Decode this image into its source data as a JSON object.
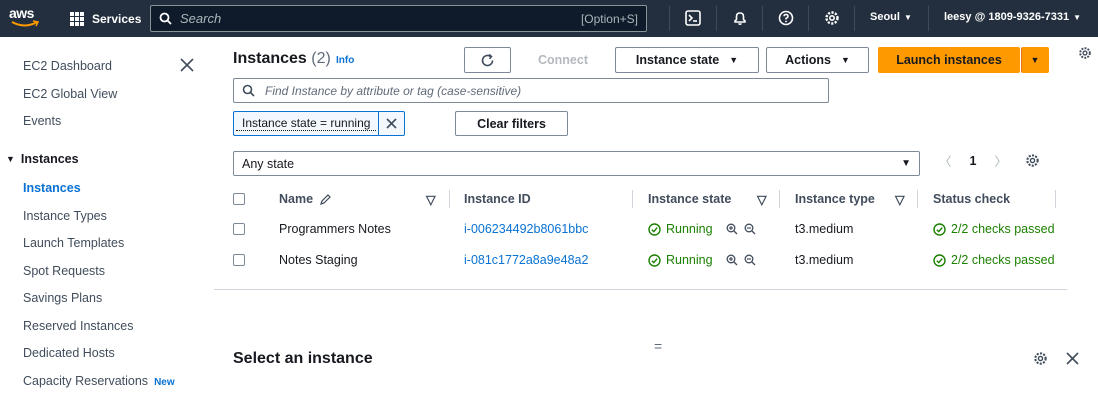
{
  "topnav": {
    "logo_text": "aws",
    "services_label": "Services",
    "search_placeholder": "Search",
    "search_shortcut": "[Option+S]",
    "region": "Seoul",
    "account": "leesy @ 1809-9326-7331",
    "icons": [
      "cloudshell-icon",
      "bell-icon",
      "help-icon",
      "settings-icon"
    ]
  },
  "sidebar": {
    "items": [
      {
        "label": "EC2 Dashboard"
      },
      {
        "label": "EC2 Global View"
      },
      {
        "label": "Events"
      }
    ],
    "section": "Instances",
    "sub_items": [
      {
        "label": "Instances",
        "active": true
      },
      {
        "label": "Instance Types"
      },
      {
        "label": "Launch Templates"
      },
      {
        "label": "Spot Requests"
      },
      {
        "label": "Savings Plans"
      },
      {
        "label": "Reserved Instances"
      },
      {
        "label": "Dedicated Hosts"
      },
      {
        "label": "Capacity Reservations",
        "badge": "New"
      }
    ]
  },
  "main": {
    "title": "Instances",
    "count": "(2)",
    "info": "Info",
    "connect_label": "Connect",
    "instance_state_label": "Instance state",
    "actions_label": "Actions",
    "launch_label": "Launch instances",
    "find_placeholder": "Find Instance by attribute or tag (case-sensitive)",
    "filter_token": "Instance state = running",
    "clear_filters_label": "Clear filters",
    "state_select": "Any state",
    "page_number": "1",
    "columns": [
      "Name",
      "Instance ID",
      "Instance state",
      "Instance type",
      "Status check"
    ],
    "rows": [
      {
        "name": "Programmers Notes",
        "id": "i-006234492b8061bbc",
        "state": "Running",
        "type": "t3.medium",
        "status": "2/2 checks passed"
      },
      {
        "name": "Notes Staging",
        "id": "i-081c1772a8a9e48a2",
        "state": "Running",
        "type": "t3.medium",
        "status": "2/2 checks passed"
      }
    ],
    "select_instance_label": "Select an instance",
    "split_handle": "="
  },
  "colors": {
    "nav_bg": "#232f3e",
    "accent": "#ff9900",
    "link": "#0972d3",
    "success": "#1d8102"
  }
}
